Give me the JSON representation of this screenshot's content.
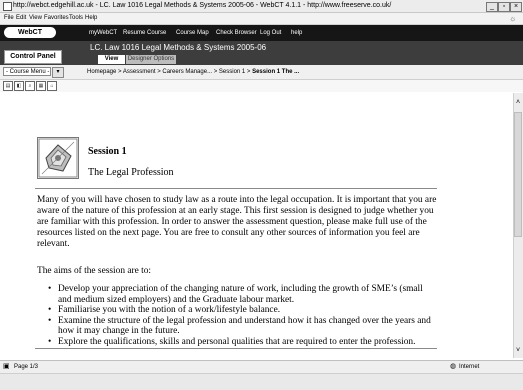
{
  "window": {
    "title": "http://webct.edgehill.ac.uk - LC. Law 1016 Legal Methods & Systems 2005-06 - WebCT 4.1.1 - http://www.freeserve.co.uk/",
    "minimize": "_",
    "restore": "▫",
    "close": "×"
  },
  "menubar": {
    "items": [
      "File",
      "Edit",
      "View",
      "Favorites",
      "Tools",
      "Help"
    ]
  },
  "webct": {
    "logo_text": "WebCT",
    "nav": [
      "myWebCT",
      "Resume Course",
      "Course Map",
      "Check Browser",
      "Log Out",
      "help"
    ]
  },
  "course": {
    "control_panel": "Control Panel",
    "title": "LC. Law 1016 Legal Methods & Systems 2005-06",
    "tab_view": "View",
    "tab_designer": "Designer Options"
  },
  "crumbs": {
    "course_menu": "- Course Menu -",
    "dropdown_arrow": "▾",
    "path_plain": "Homepage > Assessment > Careers Manage... > Session 1 > ",
    "path_bold": "Session 1 The ..."
  },
  "toolbar": {
    "icons": [
      "page-icon",
      "bookmark-icon",
      "search-icon",
      "print-icon",
      "home-icon"
    ]
  },
  "content": {
    "session_title": "Session 1",
    "session_subtitle": "The Legal Profession",
    "intro": "Many of you will have chosen to study law as a route into the legal occupation. It is important that you are aware of the nature of this profession at an early stage. This first session is designed to judge whether you are familiar with this profession. In order to answer the assessment question, please make full use of the resources listed on the next page. You are free to consult any other sources of information you feel are relevant.",
    "aims_heading": "The aims of the session are to:",
    "bullets": [
      "Develop your appreciation of the changing nature of work, including the growth of SME’s (small and medium sized employers) and the Graduate labour market.",
      "Familiarise you with the notion of a work/lifestyle balance.",
      "Examine the structure of the legal profession and understand how it has changed over the years and how it may change in the future.",
      "Explore the qualifications, skills and personal qualities that are required to enter the profession."
    ]
  },
  "status": {
    "page": "Page 1/3",
    "zone": "Internet"
  }
}
